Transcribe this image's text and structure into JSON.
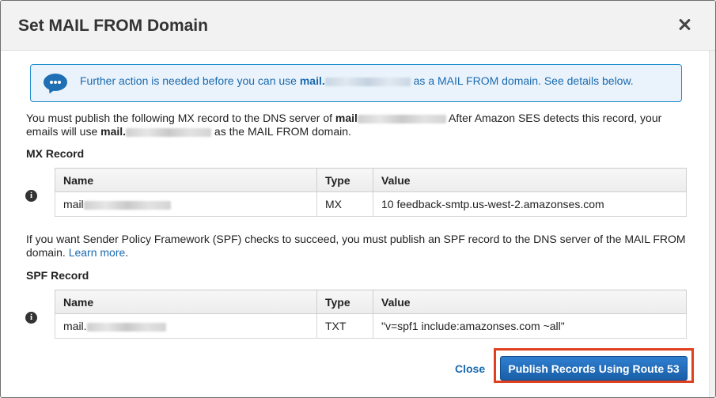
{
  "dialog": {
    "title": "Set MAIL FROM Domain",
    "close_icon": "close-icon"
  },
  "notice": {
    "icon": "chat-bubble-icon",
    "text_before": "Further action is needed before you can use ",
    "domain": "mail.",
    "text_after": " as a MAIL FROM domain. See details below."
  },
  "mx_intro": {
    "part1": "You must publish the following MX record to the DNS server of ",
    "domain1": "mail",
    "part2": " After Amazon SES detects this record, your",
    "part3": "emails will use ",
    "domain2": "mail.",
    "part4": " as the MAIL FROM domain."
  },
  "mx_section": {
    "title": "MX Record",
    "columns": [
      "Name",
      "Type",
      "Value"
    ],
    "row": {
      "name": "mail",
      "type": "MX",
      "value": "10 feedback-smtp.us-west-2.amazonses.com"
    }
  },
  "spf_intro": {
    "text": "If you want Sender Policy Framework (SPF) checks to succeed, you must publish an SPF record to the DNS server of the MAIL FROM",
    "text2": "domain.",
    "link": "Learn more",
    "end": "."
  },
  "spf_section": {
    "title": "SPF Record",
    "columns": [
      "Name",
      "Type",
      "Value"
    ],
    "row": {
      "name": "mail.",
      "type": "TXT",
      "value": "\"v=spf1 include:amazonses.com ~all\""
    }
  },
  "footer": {
    "close_label": "Close",
    "publish_label": "Publish Records Using Route 53"
  },
  "colors": {
    "accent": "#1a6ab0",
    "highlight": "#e0401f",
    "notice_bg": "#eaf3fb"
  }
}
